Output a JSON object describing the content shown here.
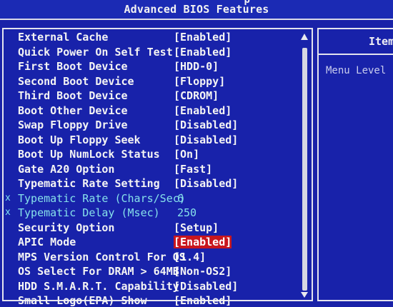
{
  "header": {
    "title": "Advanced BIOS Features",
    "ghost_text": "' p''''''''''''''"
  },
  "settings": [
    {
      "label": "External Cache",
      "value": "[Enabled]"
    },
    {
      "label": "Quick Power On Self Test",
      "value": "[Enabled]"
    },
    {
      "label": "First Boot Device",
      "value": "[HDD-0]"
    },
    {
      "label": "Second Boot Device",
      "value": "[Floppy]"
    },
    {
      "label": "Third Boot Device",
      "value": "[CDROM]"
    },
    {
      "label": "Boot Other Device",
      "value": "[Enabled]"
    },
    {
      "label": "Swap Floppy Drive",
      "value": "[Disabled]"
    },
    {
      "label": "Boot Up Floppy Seek",
      "value": "[Disabled]"
    },
    {
      "label": "Boot Up NumLock Status",
      "value": "[On]"
    },
    {
      "label": "Gate A20 Option",
      "value": "[Fast]"
    },
    {
      "label": "Typematic Rate Setting",
      "value": "[Disabled]"
    },
    {
      "label": "Typematic Rate (Chars/Sec)",
      "value": "6",
      "mark": "x"
    },
    {
      "label": "Typematic Delay (Msec)",
      "value": "250",
      "mark": "x"
    },
    {
      "label": "Security Option",
      "value": "[Setup]"
    },
    {
      "label": "APIC Mode",
      "value": "[Enabled]"
    },
    {
      "label": "MPS Version Control For OS",
      "value": "[1.4]"
    },
    {
      "label": "OS Select For DRAM > 64MB",
      "value": "[Non-OS2]"
    },
    {
      "label": "HDD S.M.A.R.T. Capability",
      "value": "[Disabled]"
    },
    {
      "label": "Small Logo(EPA) Show",
      "value": "[Enabled]"
    }
  ],
  "help_panel": {
    "header": "Item",
    "menu_level": "Menu Level"
  },
  "colors": {
    "background": "#1a22a8",
    "text": "#f4f4f4",
    "disabled_text": "#86e0ea",
    "highlight": "#c8161e"
  }
}
